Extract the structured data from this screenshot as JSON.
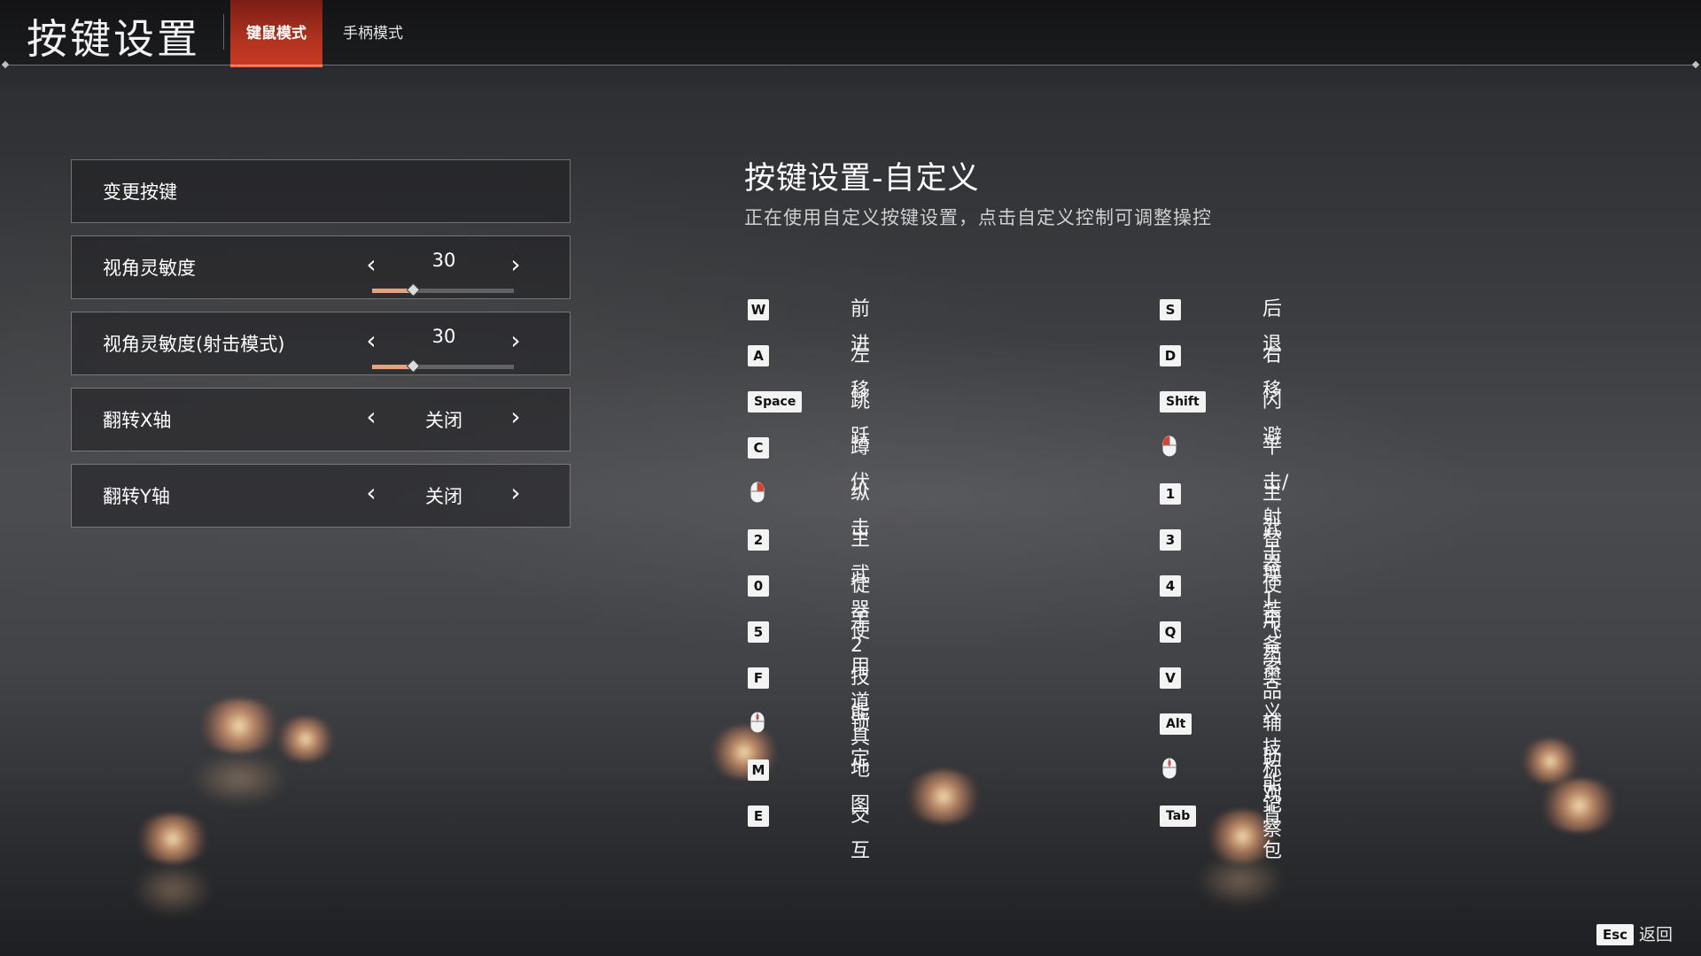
{
  "header": {
    "title": "按键设置",
    "tabs": [
      {
        "label": "键鼠模式",
        "active": true
      },
      {
        "label": "手柄模式",
        "active": false
      }
    ]
  },
  "settings": [
    {
      "label": "变更按键"
    },
    {
      "label": "视角灵敏度",
      "value": "30",
      "slider_fraction": 0.29
    },
    {
      "label": "视角灵敏度(射击模式)",
      "value": "30",
      "slider_fraction": 0.29
    },
    {
      "label": "翻转X轴",
      "value": "关闭"
    },
    {
      "label": "翻转Y轴",
      "value": "关闭"
    }
  ],
  "keybinds": {
    "title": "按键设置-自定义",
    "subtitle": "正在使用自定义按键设置，点击自定义控制可调整操控",
    "left": [
      {
        "key": "W",
        "action": "前进"
      },
      {
        "key": "A",
        "action": "左移"
      },
      {
        "key": "Space",
        "action": "跳跃"
      },
      {
        "key": "C",
        "action": "蹲伏"
      },
      {
        "key": "mouse-right-icon",
        "action": "纵击"
      },
      {
        "key": "2",
        "action": "主武器2"
      },
      {
        "key": "0",
        "action": "徒手"
      },
      {
        "key": "5",
        "action": "使用道具"
      },
      {
        "key": "F",
        "action": "技能"
      },
      {
        "key": "mouse-middle-icon",
        "action": "锁定"
      },
      {
        "key": "M",
        "action": "地图"
      },
      {
        "key": "E",
        "action": "交互"
      }
    ],
    "right": [
      {
        "key": "S",
        "action": "后退"
      },
      {
        "key": "D",
        "action": "右移"
      },
      {
        "key": "Shift",
        "action": "闪避"
      },
      {
        "key": "mouse-left-icon",
        "action": "平击/射击"
      },
      {
        "key": "1",
        "action": "主武器1"
      },
      {
        "key": "3",
        "action": "替换装备"
      },
      {
        "key": "4",
        "action": "使用药品"
      },
      {
        "key": "Q",
        "action": "飞索"
      },
      {
        "key": "V",
        "action": "奥义技能"
      },
      {
        "key": "Alt",
        "action": "辅助观察"
      },
      {
        "key": "mouse-middle-icon",
        "action": "标记"
      },
      {
        "key": "Tab",
        "action": "背包"
      }
    ]
  },
  "footer": {
    "key": "Esc",
    "label": "返回"
  },
  "colors": {
    "accent_tab": "#c93a23",
    "slider_fill": "#e2a37e",
    "keycap_bg": "#f3f3f3",
    "mouse_highlight": "#e0402a"
  }
}
